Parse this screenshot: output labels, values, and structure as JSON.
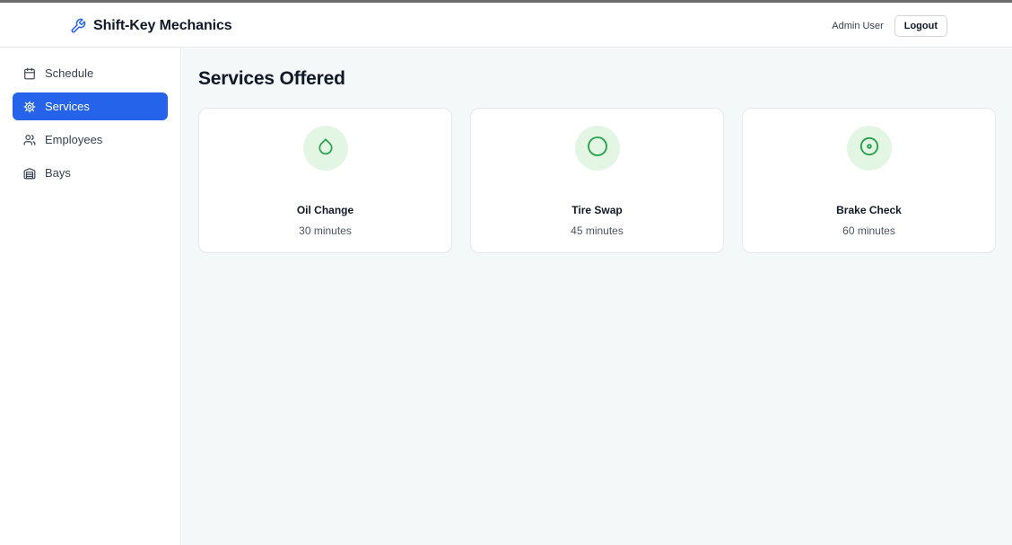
{
  "header": {
    "brand_name": "Shift-Key Mechanics",
    "brand_icon": "wrench-icon",
    "user_name": "Admin User",
    "logout_label": "Logout"
  },
  "sidebar": {
    "items": [
      {
        "label": "Schedule",
        "icon": "calendar-icon",
        "active": false
      },
      {
        "label": "Services",
        "icon": "gear-icon",
        "active": true
      },
      {
        "label": "Employees",
        "icon": "users-icon",
        "active": false
      },
      {
        "label": "Bays",
        "icon": "warehouse-icon",
        "active": false
      }
    ]
  },
  "main": {
    "title": "Services Offered",
    "services": [
      {
        "name": "Oil Change",
        "duration": "30 minutes",
        "icon": "droplet-icon"
      },
      {
        "name": "Tire Swap",
        "duration": "45 minutes",
        "icon": "circle-icon"
      },
      {
        "name": "Brake Check",
        "duration": "60 minutes",
        "icon": "disc-icon"
      }
    ]
  },
  "colors": {
    "accent": "#2563eb",
    "icon_green": "#22a04a",
    "icon_bg": "#e3f5e3",
    "main_bg": "#f4f8f8"
  }
}
